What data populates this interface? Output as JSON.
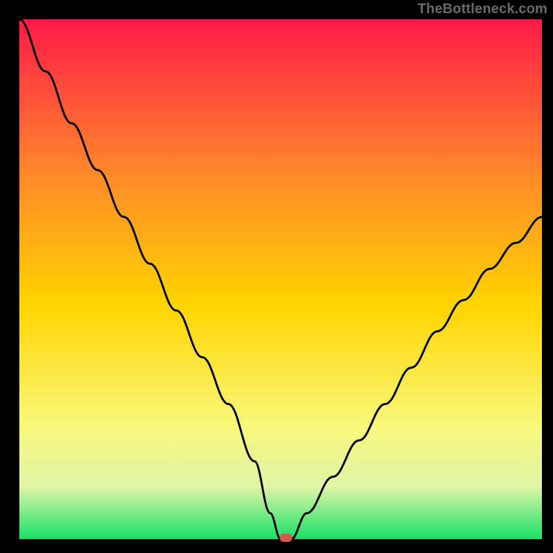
{
  "watermark": "TheBottleneck.com",
  "chart_data": {
    "type": "line",
    "title": "",
    "xlabel": "",
    "ylabel": "",
    "xlim": [
      0,
      100
    ],
    "ylim": [
      0,
      100
    ],
    "grid": false,
    "legend": false,
    "background_gradient": {
      "top": "#ff1a49",
      "mid1": "#ff8a2a",
      "mid2": "#ffd400",
      "mid3": "#faf87a",
      "mid4": "#dff5a8",
      "bottom": "#17e067"
    },
    "series": [
      {
        "name": "bottleneck-curve",
        "x": [
          0,
          5,
          10,
          15,
          20,
          25,
          30,
          35,
          40,
          45,
          48,
          50,
          52,
          55,
          60,
          65,
          70,
          75,
          80,
          85,
          90,
          95,
          100
        ],
        "values": [
          100,
          90,
          80,
          71,
          62,
          53,
          44,
          35,
          26,
          15,
          5,
          0,
          0,
          5,
          12,
          19,
          26,
          33,
          40,
          46,
          52,
          57,
          62
        ]
      }
    ],
    "marker": {
      "x": 51,
      "y": 0,
      "color": "#d65a4a"
    }
  }
}
